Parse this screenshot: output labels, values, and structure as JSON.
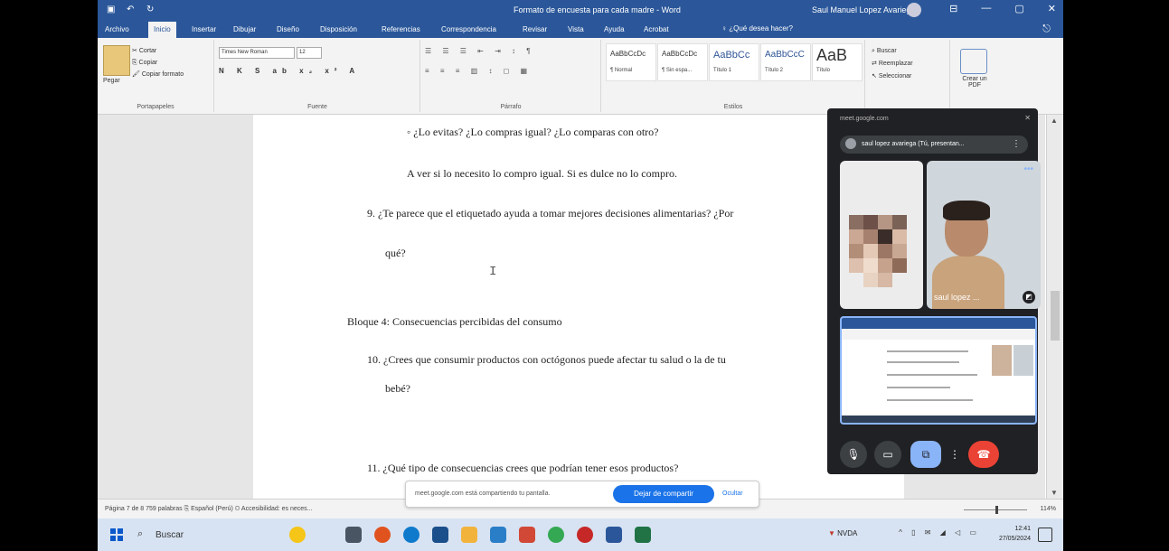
{
  "window": {
    "title": "Formato de encuesta para cada madre - Word",
    "user": "Saul Manuel Lopez Avariega",
    "controls": [
      "⊟",
      "—",
      "▢",
      "✕"
    ]
  },
  "ribbon_tabs": [
    "Archivo",
    "Inicio",
    "Insertar",
    "Dibujar",
    "Diseño",
    "Disposición",
    "Referencias",
    "Correspondencia",
    "Revisar",
    "Vista",
    "Ayuda",
    "Acrobat"
  ],
  "help_search": "¿Qué desea hacer?",
  "clipboard": {
    "paste": "Pegar",
    "cut": "Cortar",
    "copy": "Copiar",
    "format_painter": "Copiar formato",
    "label": "Portapapeles"
  },
  "font": {
    "name": "Times New Roman",
    "size": "12",
    "label": "Fuente",
    "format_row": "N K S ab x₂ x² A"
  },
  "paragraph": {
    "label": "Párrafo",
    "row1": "☰ ☰ ☰ ⇤ ⇥ ↕ ¶",
    "row2": "≡ ≡ ≡ ▥ ↕ ◻ ▦"
  },
  "styles": {
    "label": "Estilos",
    "items": [
      {
        "sample": "AaBbCcDc",
        "name": "¶ Normal"
      },
      {
        "sample": "AaBbCcDc",
        "name": "¶ Sin espa..."
      },
      {
        "sample": "AaBbCc",
        "name": "Título 1"
      },
      {
        "sample": "AaBbCcC",
        "name": "Título 2"
      },
      {
        "sample": "AaB",
        "name": "Título"
      }
    ]
  },
  "editing": {
    "find": "Buscar",
    "replace": "Reemplazar",
    "select": "Seleccionar",
    "pdf": "Crear un PDF"
  },
  "document": {
    "line1": "◦   ¿Lo evitas? ¿Lo compras igual? ¿Lo comparas con otro?",
    "line2": "A ver si lo necesito lo compro igual. Si es dulce no lo compro.",
    "q9a": "9.   ¿Te parece que el etiquetado ayuda a tomar mejores decisiones alimentarias? ¿Por",
    "q9b": "qué?",
    "block4": "Bloque 4: Consecuencias percibidas del consumo",
    "q10a": "10. ¿Crees que consumir productos con octógonos puede afectar tu salud o la de tu",
    "q10b": "bebé?",
    "q11": "11. ¿Qué tipo de consecuencias crees que podrían tener esos productos?"
  },
  "meet": {
    "url": "meet.google.com",
    "presenter": "saul lopez avariega (Tú, presentan...",
    "participant_name": "saul lopez ...",
    "more": "•••"
  },
  "share_bar": {
    "text": "meet.google.com está compartiendo tu pantalla.",
    "stop": "Dejar de compartir",
    "hide": "Ocultar"
  },
  "status": {
    "left": "Página 7 de 8   759 palabras   ⎘   Español (Perú)   ⚇ Accesibilidad: es neces...",
    "zoom": "114%"
  },
  "taskbar": {
    "search": "Buscar",
    "stock_name": "NVDA",
    "stock_change": "▼",
    "time": "12:41",
    "date": "27/05/2024"
  }
}
